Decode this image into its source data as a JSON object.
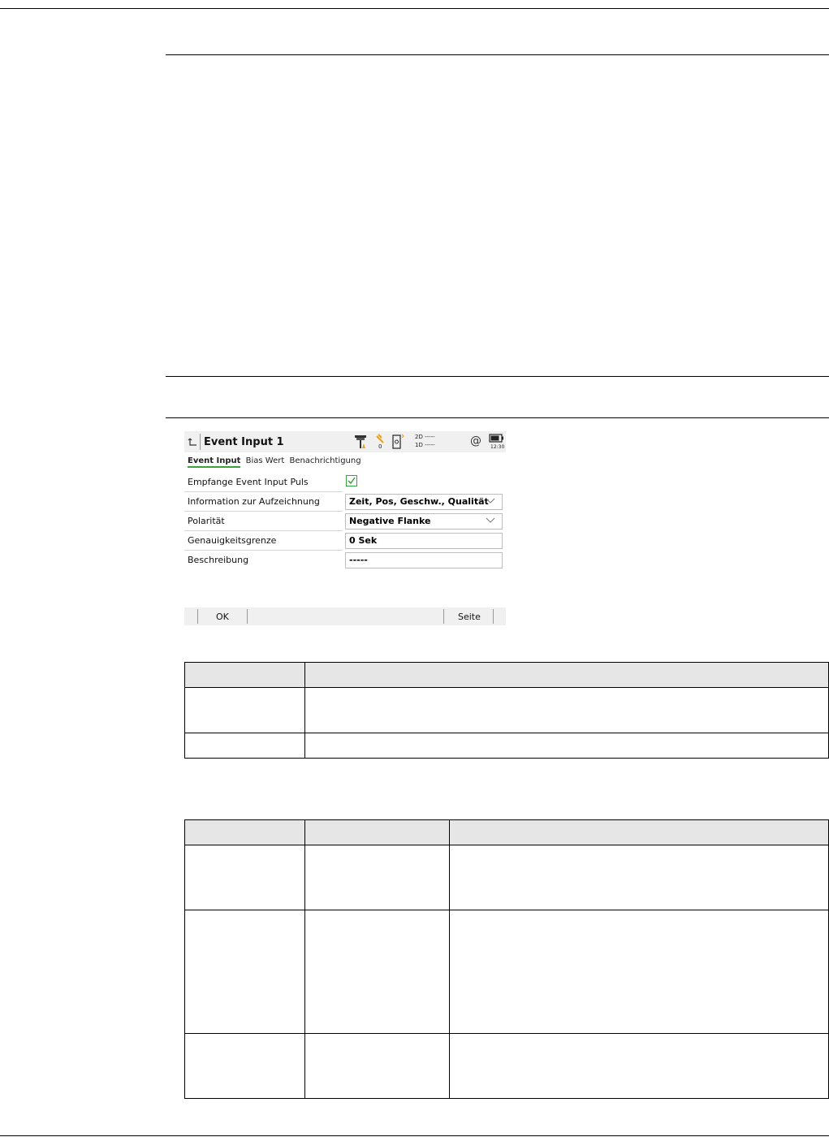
{
  "screen": {
    "title": "Event Input 1",
    "status": {
      "satellites_count": "0",
      "line_2d": "2D -----",
      "line_1d": "1D -----",
      "at_symbol": "@",
      "time": "12:30"
    },
    "tabs": [
      "Event Input",
      "Bias Wert",
      "Benachrichtigung"
    ],
    "fields": {
      "receive_label": "Empfange Event Input Puls",
      "receive_checked": true,
      "info_label": "Information zur Aufzeichnung",
      "info_value": "Zeit, Pos, Geschw., Qualität",
      "polarity_label": "Polarität",
      "polarity_value": "Negative Flanke",
      "accuracy_label": "Genauigkeitsgrenze",
      "accuracy_value": "0 Sek",
      "description_label": "Beschreibung",
      "description_value": "-----"
    },
    "softkeys": {
      "ok": "OK",
      "page": "Seite"
    },
    "accent_color": "#3aa23a"
  }
}
